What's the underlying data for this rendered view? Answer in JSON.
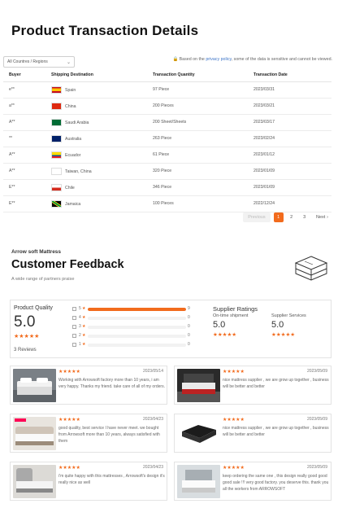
{
  "page_title": "Product Transaction Details",
  "filter": {
    "selected": "All Countres / Regions"
  },
  "notice": {
    "before": "Based on the ",
    "link": "privacy policy",
    "after": ", some of the data is sensitive and cannot be viewed."
  },
  "table": {
    "headers": [
      "Buyer",
      "Shipping Destination",
      "Transaction Quantity",
      "Transaction Date"
    ],
    "rows": [
      {
        "buyer": "e**",
        "country": "Spain",
        "flag": "spain",
        "qty": "97 Piece",
        "date": "2023/03/31"
      },
      {
        "buyer": "a**",
        "country": "China",
        "flag": "china",
        "qty": "200 Pieces",
        "date": "2023/03/21"
      },
      {
        "buyer": "A**",
        "country": "Saudi Arabia",
        "flag": "saudi-arabia",
        "qty": "200 Sheet/Sheets",
        "date": "2023/03/17"
      },
      {
        "buyer": "**",
        "country": "Australia",
        "flag": "australia",
        "qty": "263 Piece",
        "date": "2023/02/24"
      },
      {
        "buyer": "A**",
        "country": "Ecuador",
        "flag": "ecuador",
        "qty": "61 Piece",
        "date": "2023/01/12"
      },
      {
        "buyer": "A**",
        "country": "Taiwan, China",
        "flag": "blank",
        "qty": "320 Piece",
        "date": "2023/01/09"
      },
      {
        "buyer": "E**",
        "country": "Chile",
        "flag": "chile",
        "qty": "346 Piece",
        "date": "2023/01/09"
      },
      {
        "buyer": "E**",
        "country": "Jamaica",
        "flag": "jamaica",
        "qty": "100 Pieces",
        "date": "2022/12/24"
      }
    ]
  },
  "pagination": {
    "prev": "Previous",
    "pages": [
      "1",
      "2",
      "3"
    ],
    "current": "1",
    "next": "Next"
  },
  "feedback": {
    "brand": "Arrow soft Mattress",
    "title": "Customer Feedback",
    "tagline": "A wide range of partners praise"
  },
  "rating": {
    "label": "Product Quality",
    "score": "5.0",
    "stars": "★★★★★",
    "reviews": "3 Reviews",
    "breakdown": [
      {
        "star": "5",
        "count": "9",
        "fraction": 1.0
      },
      {
        "star": "4",
        "count": "0",
        "fraction": 0
      },
      {
        "star": "3",
        "count": "0",
        "fraction": 0
      },
      {
        "star": "2",
        "count": "0",
        "fraction": 0
      },
      {
        "star": "1",
        "count": "0",
        "fraction": 0
      }
    ],
    "supplier": {
      "label": "Supplier Ratings",
      "ontime_label": "On-time shipment",
      "ontime": "5.0",
      "service_label": "Supplier Services",
      "service": "5.0",
      "stars": "★★★★★"
    }
  },
  "reviews": [
    {
      "stars": "★★★★★",
      "date": "2023/05/14",
      "text": "Working with Arrowsoft factory more than 10 years, i am very happy. Thanks my friend. take care of all of my orders."
    },
    {
      "stars": "★★★★★",
      "date": "2023/05/09",
      "text": "nice mattress supplier , we are grow up together , business will be better and better"
    },
    {
      "stars": "★★★★★",
      "date": "2023/04/23",
      "text": "good quality, best service I have never meet. we bought from Arrowsoft more than 10 years, always satisfied with them"
    },
    {
      "stars": "★★★★★",
      "date": "2023/05/09",
      "text": "nice mattress supplier , we are grow up together , business will be better and better"
    },
    {
      "stars": "★★★★★",
      "date": "2023/04/23",
      "text": "i'm quite happy with this mattresses , Arrowsoft's design it's really nice as well"
    },
    {
      "stars": "★★★★★",
      "date": "2023/05/09",
      "text": "keep ordering the same one , this design really good good good sale !!! very good factory. you deserve this. thank you all the workers from ARROWSOFT"
    }
  ]
}
